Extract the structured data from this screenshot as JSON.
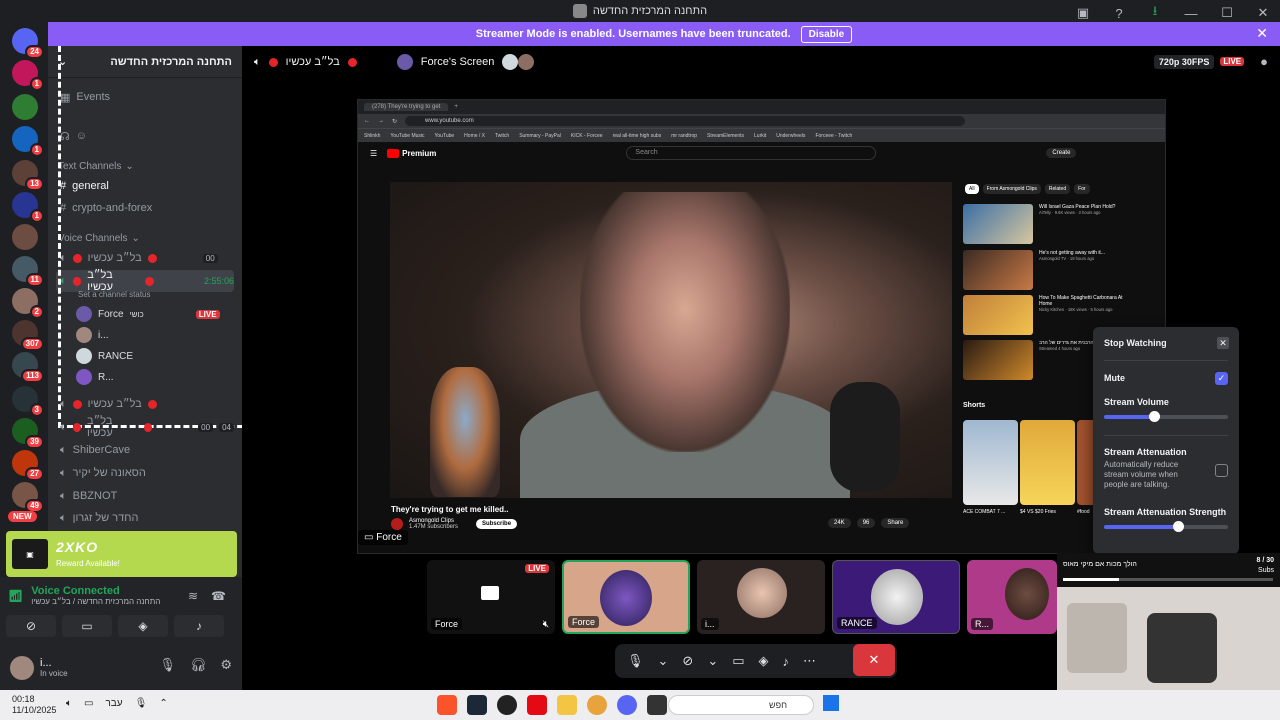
{
  "window": {
    "title": "התחנה המרכזית החדשה",
    "controls": [
      "—",
      "☐",
      "✕"
    ]
  },
  "banner": {
    "text": "Streamer Mode is enabled. Usernames have been truncated.",
    "button": "Disable"
  },
  "rail": {
    "badges": [
      "24",
      "1",
      "1",
      "13",
      "1",
      "11",
      "2",
      "307",
      "113",
      "3",
      "39",
      "27",
      "49"
    ],
    "new_label": "NEW"
  },
  "sidebar": {
    "server_name": "התחנה המרכזית החדשה",
    "events": "Events",
    "category_text": "Text Channels",
    "text_channels": [
      "general",
      "crypto-and-forex"
    ],
    "category_voice": "Voice Channels",
    "voice_top": "בל״ב עכשיו",
    "voice_active": "בל״ב עכשיו",
    "active_timer": "2:55:06",
    "chip_00": "00",
    "chip_04": "04",
    "set_status": "Set a channel status",
    "vc_users": [
      "Force",
      "i...",
      "RANCE",
      "R..."
    ],
    "force_suffix": "כושי",
    "live_label": "LIVE",
    "more_voice": [
      "בל״ב עכשיו",
      "בל״ב עכשיו",
      "ShiberCave",
      "הסאונה של יקיר",
      "BBZNOT",
      "החדר של זגרון"
    ]
  },
  "reward": {
    "title": "2XKO",
    "subtitle": "Reward Available!"
  },
  "voice_panel": {
    "status": "Voice Connected",
    "location": "התחנה המרכזית החדשה / בל״ב עכשיו"
  },
  "user_panel": {
    "name": "i...",
    "status": "In voice"
  },
  "stage": {
    "voice_channel": "בל״ב עכשיו",
    "screen_title": "Force's Screen",
    "quality": "720p 30FPS",
    "live": "LIVE"
  },
  "browser": {
    "tab": "(278) They're trying to get",
    "url": "www.youtube.com",
    "bookmarks": [
      "Shlinkh",
      "YouTube Music",
      "YouTube",
      "Home / X",
      "Twitch",
      "Summary - PayPal",
      "KICK - Forcee",
      "real all-time high subs",
      "mr randtrop",
      "StreamElements",
      "Lurkit",
      "Underwheels",
      "Forceee - Twitch"
    ],
    "yt_logo": "Premium",
    "search": "Search",
    "create": "Create",
    "video_title": "They're trying to get me killed..",
    "channel": "Asmongold Clips",
    "subs": "1.47M subscribers",
    "subscribe": "Subscribe",
    "likes": "24K",
    "dislikes": "96",
    "share": "Share",
    "chips": [
      "All",
      "From Asmongold Clips",
      "Related",
      "For"
    ],
    "recs": [
      {
        "title": "Will Israel Gaza Peace Plan Hold?",
        "meta": "AiTelly · 9.6K views · 3 hours ago"
      },
      {
        "title": "He's not getting away with it...",
        "meta": "Asmongold TV · 19 hours ago"
      },
      {
        "title": "How To Make Spaghetti Carbonara At Home",
        "meta": "Nicky Kitchen · 18K views · 5 hours ago"
      },
      {
        "title": "הרבנית את גדרים של הרב",
        "meta": "Streamed 4 hours ago"
      }
    ],
    "shorts_label": "Shorts",
    "shorts": [
      "ACE COMBAT 7 ...",
      "$4 VS $20 Fries",
      "#food"
    ],
    "force_tag": "Force"
  },
  "popup": {
    "stop_watching": "Stop Watching",
    "mute": "Mute",
    "stream_volume": "Stream Volume",
    "attenuation": "Stream Attenuation",
    "attenuation_desc": "Automatically reduce stream volume when people are talking.",
    "attenuation_strength": "Stream Attenuation Strength",
    "mute_checked": true,
    "volume_level": 0.4,
    "strength_level": 0.6
  },
  "tiles": [
    "Force",
    "Force",
    "i...",
    "RANCE",
    "R..."
  ],
  "tile_live": "LIVE",
  "overlay": {
    "caption": "הולך מכות אם מיקי מאוס",
    "count": "8 / 30",
    "subs": "Subs"
  },
  "taskbar": {
    "time": "00:18",
    "date": "11/10/2025",
    "lang": "עבר",
    "search": "חפש"
  }
}
